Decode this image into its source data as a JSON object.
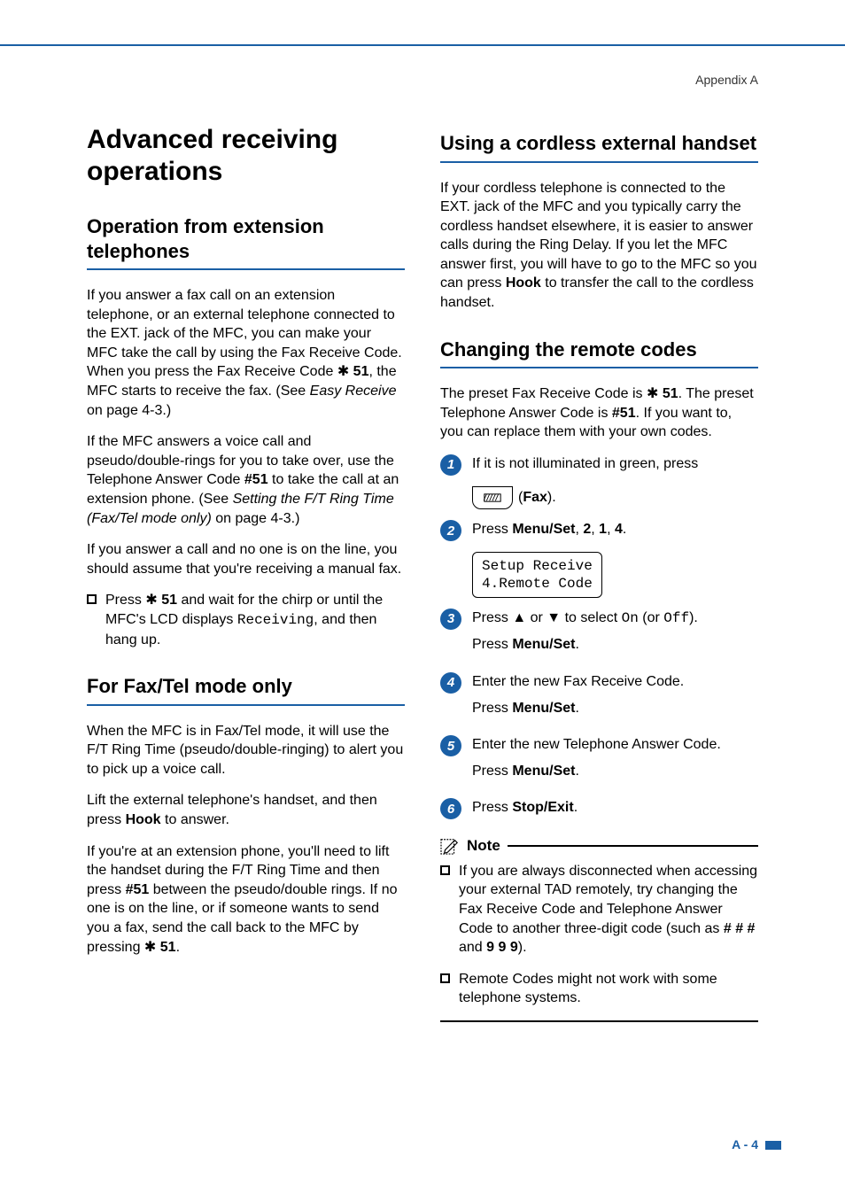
{
  "header": {
    "label": "Appendix A"
  },
  "left": {
    "h1": "Advanced receiving operations",
    "sec1": {
      "title": "Operation from extension telephones",
      "p1_a": "If you answer a fax call on an extension telephone, or an external telephone connected to the EXT. jack of the MFC, you can make your MFC take the call by using the Fax Receive Code. When you press the Fax Receive Code ",
      "p1_code": "51",
      "p1_b": ", the MFC starts to receive the fax. (See ",
      "p1_ital": "Easy Receive",
      "p1_c": " on page 4-3.)",
      "p2_a": "If the MFC answers a voice call and pseudo/double-rings for you to take over, use the Telephone Answer Code ",
      "p2_code": "#51",
      "p2_b": " to take the call at an extension phone. (See ",
      "p2_ital": "Setting the F/T Ring Time (Fax/Tel mode only)",
      "p2_c": " on page 4-3.)",
      "p3": "If you answer a call and no one is on the line, you should assume that you're receiving a manual fax.",
      "bullet_a": "Press ",
      "bullet_code": "51",
      "bullet_b": " and wait for the chirp or until the MFC's LCD displays ",
      "bullet_mono": "Receiving",
      "bullet_c": ", and then hang up."
    },
    "sec2": {
      "title": "For Fax/Tel mode only",
      "p1": "When the MFC is in Fax/Tel mode, it will use the F/T Ring Time (pseudo/double-ringing) to alert you to pick up a voice call.",
      "p2_a": "Lift the external telephone's handset, and then press ",
      "p2_bold": "Hook",
      "p2_b": " to answer.",
      "p3_a": "If you're at an extension phone, you'll need to lift the handset during the F/T Ring Time and then press ",
      "p3_code": "#51",
      "p3_b": " between the pseudo/double rings. If no one is on the line, or if someone wants to send you a fax, send the call back to the MFC by pressing ",
      "p3_code2": "51",
      "p3_c": "."
    }
  },
  "right": {
    "sec1": {
      "title": "Using a cordless external handset",
      "p1_a": "If your cordless telephone is connected to the EXT. jack of the MFC and you typically carry the cordless handset elsewhere, it is easier to answer calls during the Ring Delay. If you let the MFC answer first, you will have to go to the MFC so you can press ",
      "p1_bold": "Hook",
      "p1_b": " to transfer the call to the cordless handset."
    },
    "sec2": {
      "title": "Changing the remote codes",
      "p1_a": "The preset Fax Receive Code is ",
      "p1_code": "51",
      "p1_b": ". The preset Telephone Answer Code is ",
      "p1_code2": "#51",
      "p1_c": ". If you want to, you can replace them with your own codes.",
      "steps": [
        {
          "num": "1",
          "text_a": "If it is not illuminated in green, press",
          "fax_label": "Fax",
          "text_b": ")."
        },
        {
          "num": "2",
          "text_a": "Press ",
          "bold": "Menu/Set",
          "after": ", ",
          "b2": "2",
          "a2": ", ",
          "b3": "1",
          "a3": ", ",
          "b4": "4",
          "a4": ".",
          "lcd": "Setup Receive\n4.Remote Code"
        },
        {
          "num": "3",
          "text_a": "Press ▲ or ▼ to select ",
          "mono1": "On",
          "mid": " (or ",
          "mono2": "Off",
          "after": ").",
          "line2_a": "Press ",
          "line2_bold": "Menu/Set",
          "line2_b": "."
        },
        {
          "num": "4",
          "text_a": "Enter the new Fax Receive Code.",
          "line2_a": "Press ",
          "line2_bold": "Menu/Set",
          "line2_b": "."
        },
        {
          "num": "5",
          "text_a": "Enter the new Telephone Answer Code.",
          "line2_a": "Press ",
          "line2_bold": "Menu/Set",
          "line2_b": "."
        },
        {
          "num": "6",
          "text_a": "Press ",
          "bold": "Stop/Exit",
          "after": "."
        }
      ],
      "note": {
        "label": "Note",
        "items": [
          {
            "a": "If you are always disconnected when accessing your external TAD remotely, try changing the Fax Receive Code and Telephone Answer Code to another three-digit code (such as ",
            "b1": "# # #",
            "mid": " and ",
            "b2": "9 9 9",
            "after": ")."
          },
          {
            "a": "Remote Codes might not work with some telephone systems."
          }
        ]
      }
    }
  },
  "footer": {
    "page": "A - 4"
  }
}
